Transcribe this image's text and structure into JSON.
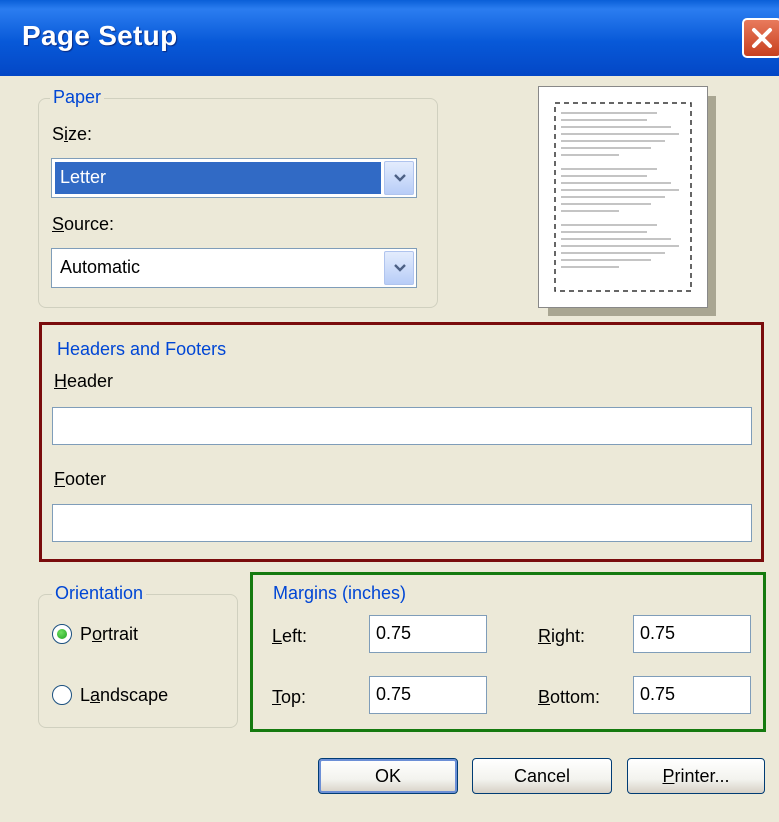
{
  "dialog": {
    "title": "Page Setup"
  },
  "paper": {
    "legend": "Paper",
    "size_label": "Size:",
    "size_value": "Letter",
    "source_label": "Source:",
    "source_value": "Automatic"
  },
  "headers_footers": {
    "legend": "Headers and Footers",
    "header_label": "Header",
    "header_value": "",
    "footer_label": "Footer",
    "footer_value": ""
  },
  "orientation": {
    "legend": "Orientation",
    "portrait_label": "Portrait",
    "landscape_label": "Landscape",
    "selected": "portrait"
  },
  "margins": {
    "legend": "Margins (inches)",
    "left_label": "Left:",
    "left_value": "0.75",
    "right_label": "Right:",
    "right_value": "0.75",
    "top_label": "Top:",
    "top_value": "0.75",
    "bottom_label": "Bottom:",
    "bottom_value": "0.75"
  },
  "buttons": {
    "ok": "OK",
    "cancel": "Cancel",
    "printer": "Printer..."
  },
  "colors": {
    "title_bar": "#0859d8",
    "dialog_bg": "#ece9d8",
    "legend_text": "#0046d5",
    "highlight_red": "#7a0c0c",
    "highlight_green": "#157a0f",
    "selection": "#316ac5"
  },
  "icons": {
    "close": "close-icon",
    "dropdown": "chevron-down-icon",
    "preview": "page-preview-icon"
  }
}
